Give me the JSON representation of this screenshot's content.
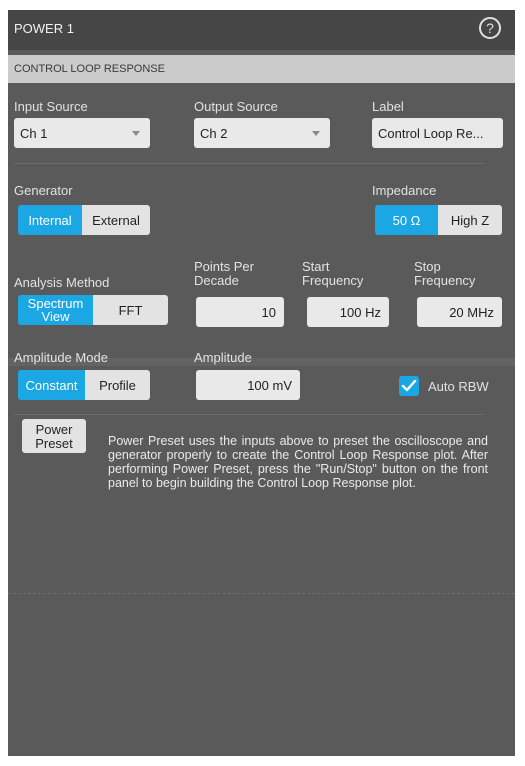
{
  "window": {
    "title": "POWER 1",
    "help_icon": "?"
  },
  "section": {
    "title": "CONTROL LOOP RESPONSE"
  },
  "input_source": {
    "label": "Input Source",
    "value": "Ch 1"
  },
  "output_source": {
    "label": "Output Source",
    "value": "Ch 2"
  },
  "label_field": {
    "label": "Label",
    "value": "Control Loop Re..."
  },
  "generator": {
    "label": "Generator",
    "options": [
      "Internal",
      "External"
    ],
    "selected": "Internal"
  },
  "impedance": {
    "label": "Impedance",
    "options": [
      "50 Ω",
      "High Z"
    ],
    "selected": "50 Ω"
  },
  "analysis_method": {
    "label": "Analysis Method",
    "options": [
      "Spectrum View",
      "FFT"
    ],
    "selected": "Spectrum View"
  },
  "points_per_decade": {
    "label": "Points Per Decade",
    "value": "10"
  },
  "start_frequency": {
    "label": "Start Frequency",
    "value": "100 Hz"
  },
  "stop_frequency": {
    "label": "Stop Frequency",
    "value": "20 MHz"
  },
  "amplitude_mode": {
    "label": "Amplitude Mode",
    "options": [
      "Constant",
      "Profile"
    ],
    "selected": "Constant"
  },
  "amplitude": {
    "label": "Amplitude",
    "value": "100 mV"
  },
  "auto_rbw": {
    "label": "Auto RBW",
    "checked": true
  },
  "power_preset": {
    "button_label": "Power Preset",
    "description": "Power Preset uses the inputs above to preset the oscilloscope and generator properly to create the Control Loop Response plot. After performing Power Preset, press the \"Run/Stop\" button on the front panel to begin building the Control Loop Response plot."
  },
  "colors": {
    "accent": "#1ba7e3",
    "panel": "#5a5a5a",
    "titlebar": "#464646",
    "section": "#cbcbcb"
  }
}
